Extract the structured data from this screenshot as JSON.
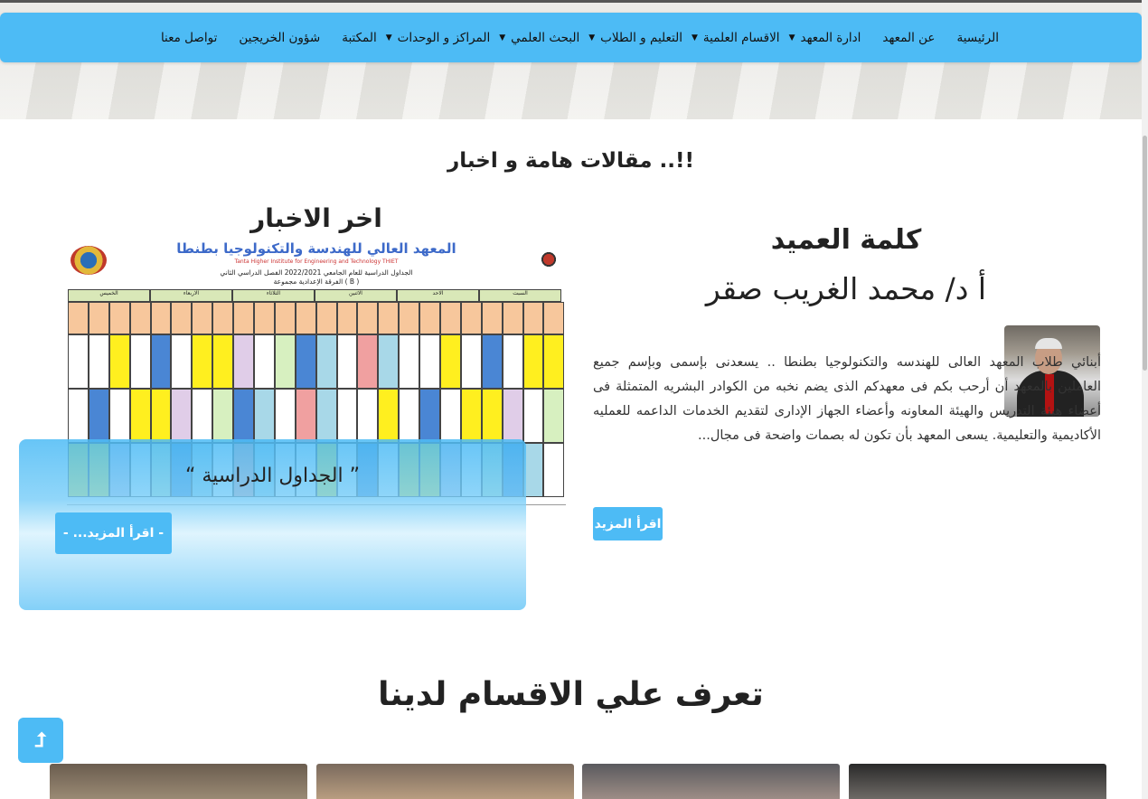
{
  "nav": {
    "items": [
      {
        "label": "الرئيسية",
        "dropdown": false
      },
      {
        "label": "عن المعهد",
        "dropdown": false
      },
      {
        "label": "ادارة المعهد",
        "dropdown": true
      },
      {
        "label": "الاقسام العلمية",
        "dropdown": true
      },
      {
        "label": "التعليم و الطلاب",
        "dropdown": true
      },
      {
        "label": "البحث العلمي",
        "dropdown": true
      },
      {
        "label": "المراكز و الوحدات",
        "dropdown": true
      },
      {
        "label": "المكتبة",
        "dropdown": false
      },
      {
        "label": "شؤون الخريجين",
        "dropdown": false
      },
      {
        "label": "تواصل معنا",
        "dropdown": false
      }
    ]
  },
  "articles": {
    "title": "مقالات هامة و اخبار ..!!"
  },
  "dean": {
    "heading": "كلمة العميد",
    "name": "أ د/ محمد الغريب صقر",
    "text": "أبنائي طلاب المعهد العالى للهندسه والتكنولوجيا بطنطا .. يسعدنى بإسمى وبإسم جميع العاملين بالمعهد أن أرحب بكم فى معهدكم الذى يضم نخبه من الكوادر البشريه المتمثلة فى أعضاء هيئة التدريس والهيئة المعاونه وأعضاء الجهاز الإدارى لتقديم الخدمات الداعمه للعمليه الأكاديمية والتعليمية. يسعى المعهد بأن تكون له بصمات واضحة فى مجال...",
    "read_more": "اقرأ المزيد"
  },
  "news": {
    "heading": "اخر الاخبار",
    "caption": "“ الجداول الدراسية ”",
    "read_more": "- ...اقرأ المزيد -",
    "schedule": {
      "institute_ar": "المعهد العالي للهندسة والتكنولوجيا بطنطا",
      "institute_en": "Tanta Higher Institute for Engineering and Technology THIET",
      "subtitle": "الجداول الدراسية للعام الجامعي 2022/2021 الفصل الدراسي الثاني",
      "group": "الفرقة الإعدادية مجموعة ( B )",
      "days": [
        "السبت",
        "الاحد",
        "الاثنين",
        "الثلاثاء",
        "الاربعاء",
        "الخميس"
      ]
    }
  },
  "departments": {
    "title": "تعرف علي الاقسام لدينا"
  },
  "scroll_top": {
    "icon": "⮥"
  },
  "colors": {
    "accent": "#4dbbf5"
  }
}
